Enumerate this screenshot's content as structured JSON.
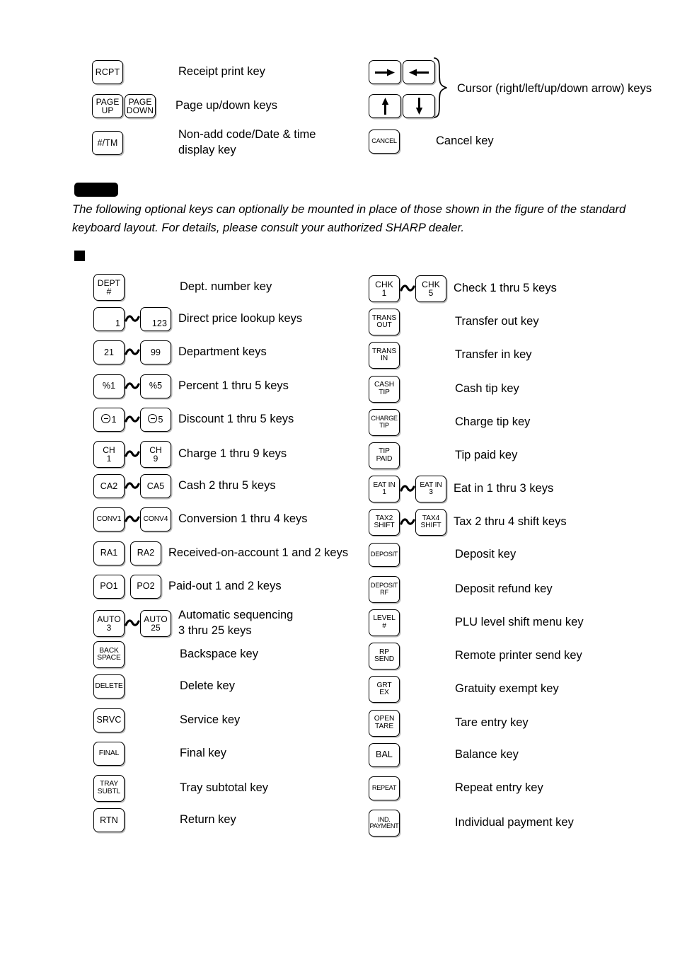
{
  "top_section": {
    "left_rows": [
      {
        "keys": [
          {
            "lines": [
              "RCPT"
            ],
            "style": "one"
          }
        ],
        "desc": "Receipt print key"
      },
      {
        "keys": [
          {
            "lines": [
              "PAGE",
              "UP"
            ],
            "style": "two"
          },
          {
            "lines": [
              "PAGE",
              "DOWN"
            ],
            "style": "two"
          }
        ],
        "desc": "Page up/down keys"
      },
      {
        "keys": [
          {
            "lines": [
              "#/TM"
            ],
            "style": "one"
          }
        ],
        "desc": "Non-add code/Date & time\ndisplay key"
      }
    ],
    "right_rows": [
      {
        "keys": [
          {
            "icon": "arrow-right-icon"
          },
          {
            "icon": "arrow-left-icon"
          }
        ],
        "desc": ""
      },
      {
        "keys": [
          {
            "icon": "arrow-up-icon"
          },
          {
            "icon": "arrow-down-icon"
          }
        ],
        "desc": ""
      },
      {
        "keys": [
          {
            "lines": [
              "CANCEL"
            ],
            "style": "xs"
          }
        ],
        "desc": "Cancel key"
      }
    ],
    "cursor_group_desc": "Cursor (right/left/up/down arrow) keys"
  },
  "note": {
    "text": "The following optional keys can optionally be mounted in place of those shown in the figure of the standard\nkeyboard layout.  For details, please consult your authorized SHARP dealer."
  },
  "optional_keys": {
    "left_column": [
      {
        "keys": [
          {
            "lines": [
              "DEPT",
              "#"
            ],
            "style": "two"
          }
        ],
        "connector": "none",
        "desc": "Dept. number key"
      },
      {
        "keys": [
          {
            "lines": [
              "1"
            ],
            "style": "br"
          },
          {
            "lines": [
              "123"
            ],
            "style": "br"
          }
        ],
        "connector": "tilde",
        "desc": "Direct price lookup keys"
      },
      {
        "keys": [
          {
            "lines": [
              "21"
            ],
            "style": "one"
          },
          {
            "lines": [
              "99"
            ],
            "style": "one"
          }
        ],
        "connector": "tilde",
        "desc": "Department keys"
      },
      {
        "keys": [
          {
            "lines": [
              "%1"
            ],
            "style": "one"
          },
          {
            "lines": [
              "%5"
            ],
            "style": "one"
          }
        ],
        "connector": "tilde",
        "desc": "Percent 1 thru 5 keys"
      },
      {
        "keys": [
          {
            "lines": [
              "⊖ 1"
            ],
            "style": "ominus1"
          },
          {
            "lines": [
              "⊖ 5"
            ],
            "style": "ominus5"
          }
        ],
        "connector": "tilde",
        "desc": "Discount 1 thru 5 keys"
      },
      {
        "keys": [
          {
            "lines": [
              "CH",
              "1"
            ],
            "style": "two"
          },
          {
            "lines": [
              "CH",
              "9"
            ],
            "style": "two"
          }
        ],
        "connector": "tilde",
        "desc": "Charge 1 thru 9 keys"
      },
      {
        "keys": [
          {
            "lines": [
              "CA2"
            ],
            "style": "one"
          },
          {
            "lines": [
              "CA5"
            ],
            "style": "one"
          }
        ],
        "connector": "tilde",
        "desc": "Cash 2 thru 5 keys"
      },
      {
        "keys": [
          {
            "lines": [
              "CONV1"
            ],
            "style": "sm"
          },
          {
            "lines": [
              "CONV4"
            ],
            "style": "sm"
          }
        ],
        "connector": "tilde",
        "desc": "Conversion 1 thru 4 keys"
      },
      {
        "keys": [
          {
            "lines": [
              "RA1"
            ],
            "style": "one"
          },
          {
            "lines": [
              "RA2"
            ],
            "style": "one"
          }
        ],
        "connector": "gap",
        "desc": "Received-on-account 1 and 2 keys"
      },
      {
        "keys": [
          {
            "lines": [
              "PO1"
            ],
            "style": "one"
          },
          {
            "lines": [
              "PO2"
            ],
            "style": "one"
          }
        ],
        "connector": "gap",
        "desc": "Paid-out 1 and 2 keys"
      },
      {
        "keys": [
          {
            "lines": [
              "AUTO",
              "3"
            ],
            "style": "two"
          },
          {
            "lines": [
              "AUTO",
              "25"
            ],
            "style": "two"
          }
        ],
        "connector": "tilde",
        "desc": "Automatic sequencing\n3 thru 25 keys"
      },
      {
        "keys": [
          {
            "lines": [
              "BACK",
              "SPACE"
            ],
            "style": "sm"
          }
        ],
        "connector": "none",
        "desc": "Backspace key"
      },
      {
        "keys": [
          {
            "lines": [
              "DELETE"
            ],
            "style": "sm"
          }
        ],
        "connector": "none",
        "desc": "Delete key"
      },
      {
        "keys": [
          {
            "lines": [
              "SRVC"
            ],
            "style": "one"
          }
        ],
        "connector": "none",
        "desc": "Service key"
      },
      {
        "keys": [
          {
            "lines": [
              "FINAL"
            ],
            "style": "sm"
          }
        ],
        "connector": "none",
        "desc": "Final key"
      },
      {
        "keys": [
          {
            "lines": [
              "TRAY",
              "SUBTL"
            ],
            "style": "sm"
          }
        ],
        "connector": "none",
        "desc": "Tray subtotal key"
      },
      {
        "keys": [
          {
            "lines": [
              "RTN"
            ],
            "style": "one"
          }
        ],
        "connector": "none",
        "desc": "Return key"
      }
    ],
    "right_column": [
      {
        "keys": [
          {
            "lines": [
              "CHK",
              "1"
            ],
            "style": "two"
          },
          {
            "lines": [
              "CHK",
              "5"
            ],
            "style": "two"
          }
        ],
        "connector": "tilde",
        "desc": "Check 1 thru 5 keys"
      },
      {
        "keys": [
          {
            "lines": [
              "TRANS",
              "OUT"
            ],
            "style": "sm"
          }
        ],
        "connector": "none",
        "desc": "Transfer out key"
      },
      {
        "keys": [
          {
            "lines": [
              "TRANS",
              "IN"
            ],
            "style": "sm"
          }
        ],
        "connector": "none",
        "desc": "Transfer in key"
      },
      {
        "keys": [
          {
            "lines": [
              "CASH",
              "TIP"
            ],
            "style": "sm"
          }
        ],
        "connector": "none",
        "desc": "Cash tip key"
      },
      {
        "keys": [
          {
            "lines": [
              "CHARGE",
              "TIP"
            ],
            "style": "xs"
          }
        ],
        "connector": "none",
        "desc": "Charge tip key"
      },
      {
        "keys": [
          {
            "lines": [
              "TIP",
              "PAID"
            ],
            "style": "sm"
          }
        ],
        "connector": "none",
        "desc": "Tip paid key"
      },
      {
        "keys": [
          {
            "lines": [
              "EAT IN",
              "1"
            ],
            "style": "sm"
          },
          {
            "lines": [
              "EAT IN",
              "3"
            ],
            "style": "sm"
          }
        ],
        "connector": "tilde",
        "desc": "Eat in 1 thru 3 keys"
      },
      {
        "keys": [
          {
            "lines": [
              "TAX2",
              "SHIFT"
            ],
            "style": "sm"
          },
          {
            "lines": [
              "TAX4",
              "SHIFT"
            ],
            "style": "sm"
          }
        ],
        "connector": "tilde",
        "desc": "Tax 2 thru 4 shift keys"
      },
      {
        "keys": [
          {
            "lines": [
              "DEPOSIT"
            ],
            "style": "xs"
          }
        ],
        "connector": "none",
        "desc": "Deposit key"
      },
      {
        "keys": [
          {
            "lines": [
              "DEPOSIT",
              "RF"
            ],
            "style": "xs"
          }
        ],
        "connector": "none",
        "desc": "Deposit refund key"
      },
      {
        "keys": [
          {
            "lines": [
              "LEVEL",
              "#"
            ],
            "style": "sm"
          }
        ],
        "connector": "none",
        "desc": "PLU level shift menu key"
      },
      {
        "keys": [
          {
            "lines": [
              "RP",
              "SEND"
            ],
            "style": "sm"
          }
        ],
        "connector": "none",
        "desc": "Remote printer send key"
      },
      {
        "keys": [
          {
            "lines": [
              "GRT",
              "EX"
            ],
            "style": "sm"
          }
        ],
        "connector": "none",
        "desc": "Gratuity exempt key"
      },
      {
        "keys": [
          {
            "lines": [
              "OPEN",
              "TARE"
            ],
            "style": "sm"
          }
        ],
        "connector": "none",
        "desc": "Tare entry key"
      },
      {
        "keys": [
          {
            "lines": [
              "BAL"
            ],
            "style": "one"
          }
        ],
        "connector": "none",
        "desc": "Balance  key"
      },
      {
        "keys": [
          {
            "lines": [
              "REPEAT"
            ],
            "style": "xs"
          }
        ],
        "connector": "none",
        "desc": "Repeat entry  key"
      },
      {
        "keys": [
          {
            "lines": [
              "IND.",
              "PAYMENT"
            ],
            "style": "xs"
          }
        ],
        "connector": "none",
        "desc": "Individual payment key"
      }
    ]
  }
}
